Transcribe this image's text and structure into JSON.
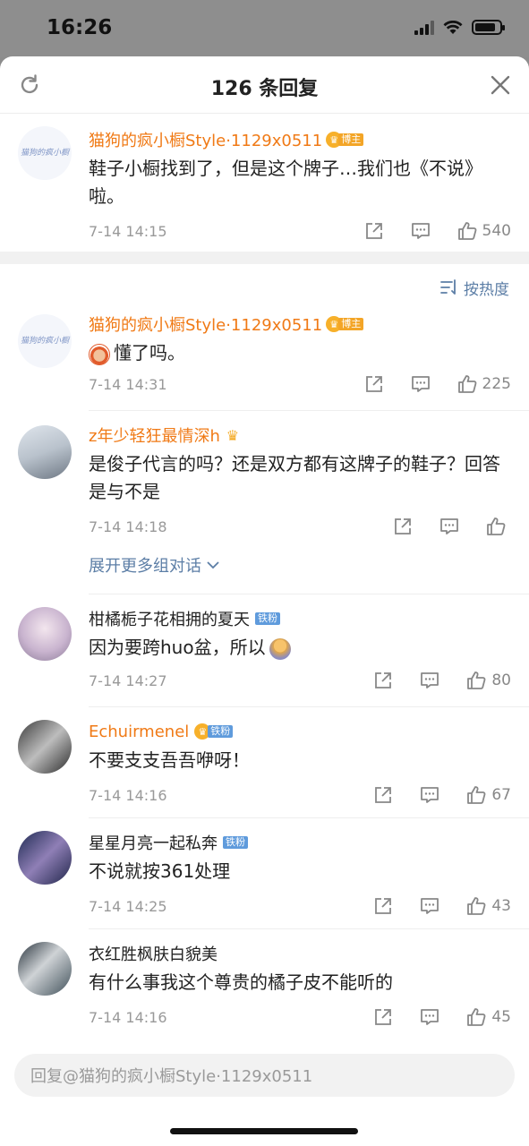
{
  "status": {
    "time": "16:26"
  },
  "header": {
    "title": "126 条回复"
  },
  "top_comment": {
    "user": "猫狗的疯小橱Style·1129x0511",
    "badge": "博主",
    "text": "鞋子小橱找到了，但是这个牌子…我们也《不说》啦。",
    "time": "7-14 14:15",
    "likes": "540",
    "avatar_text": "猫狗的疯小橱"
  },
  "sort": {
    "label": "按热度"
  },
  "comments": [
    {
      "user": "猫狗的疯小橱Style·1129x0511",
      "badge": "博主",
      "text": "懂了吗。",
      "time": "7-14 14:31",
      "likes": "225"
    },
    {
      "user": "z年少轻狂最情深h",
      "text": "是俊子代言的吗？还是双方都有这牌子的鞋子？回答是与不是",
      "time": "7-14 14:18",
      "likes": "",
      "expand": "展开更多组对话"
    },
    {
      "user": "柑橘栀子花相拥的夏天",
      "badge": "铁粉",
      "text": "因为要跨huo盆，所以",
      "time": "7-14 14:27",
      "likes": "80"
    },
    {
      "user": "Echuirmenel",
      "badge": "铁粉",
      "text": "不要支支吾吾咿呀！",
      "time": "7-14 14:16",
      "likes": "67"
    },
    {
      "user": "星星月亮一起私奔",
      "badge": "铁粉",
      "text": "不说就按361处理",
      "time": "7-14 14:25",
      "likes": "43"
    },
    {
      "user": "衣红胜枫肤白貌美",
      "text": "有什么事我这个尊贵的橘子皮不能听的",
      "time": "7-14 14:16",
      "likes": "45"
    }
  ],
  "reply_bar": {
    "placeholder": "回复@猫狗的疯小橱Style·1129x0511"
  },
  "colors": {
    "orange_name": "#f07a16",
    "link_blue": "#5c7ea6",
    "iron_fan": "#5f9bdc",
    "blogger": "#f3a527"
  }
}
